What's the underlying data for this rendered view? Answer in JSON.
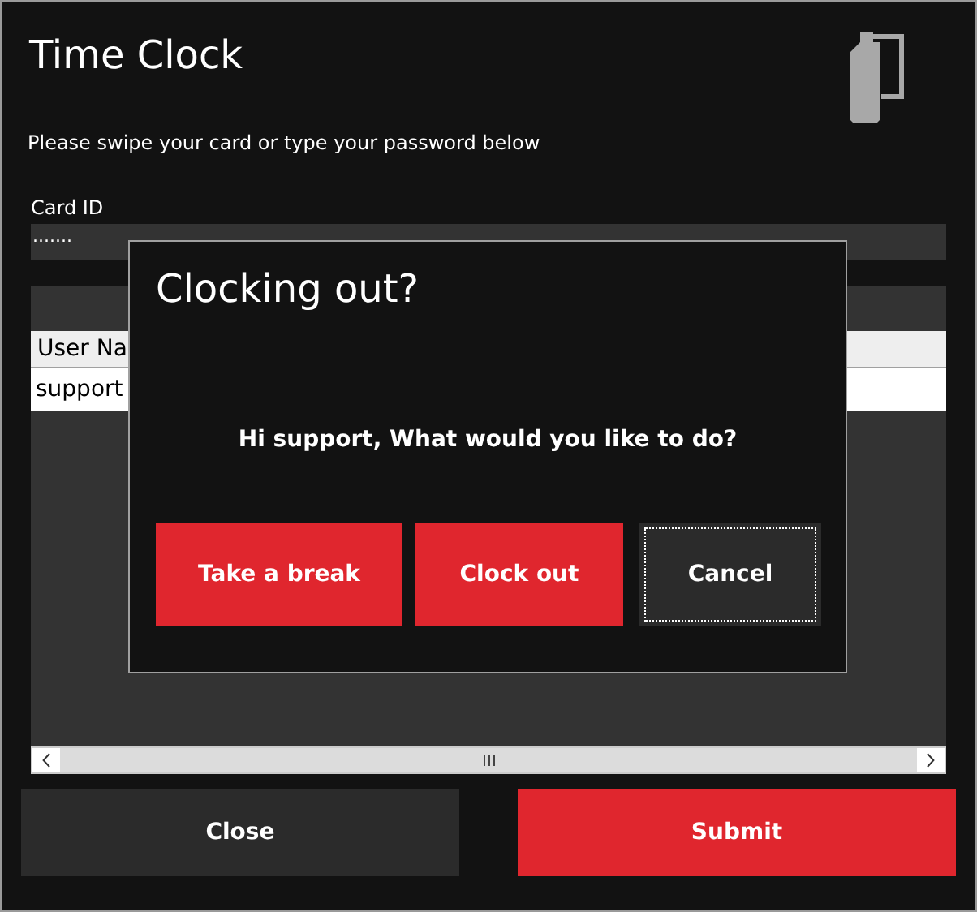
{
  "window": {
    "title": "Time Clock"
  },
  "instruction": "Please swipe your card or type your password below",
  "card_id": {
    "label": "Card ID",
    "value": "......."
  },
  "table": {
    "columns": [
      "User Na"
    ],
    "rows": [
      [
        "support"
      ]
    ]
  },
  "buttons": [
    {
      "label": "Close",
      "kind": "secondary"
    },
    {
      "label": "Submit",
      "kind": "primary"
    }
  ],
  "dialog": {
    "title": "Clocking out?",
    "message": "Hi support, What would you like to do?",
    "buttons": [
      {
        "label": "Take a break",
        "kind": "primary",
        "focused": false
      },
      {
        "label": "Clock out",
        "kind": "primary",
        "focused": false
      },
      {
        "label": "Cancel",
        "kind": "secondary",
        "focused": true
      }
    ]
  }
}
